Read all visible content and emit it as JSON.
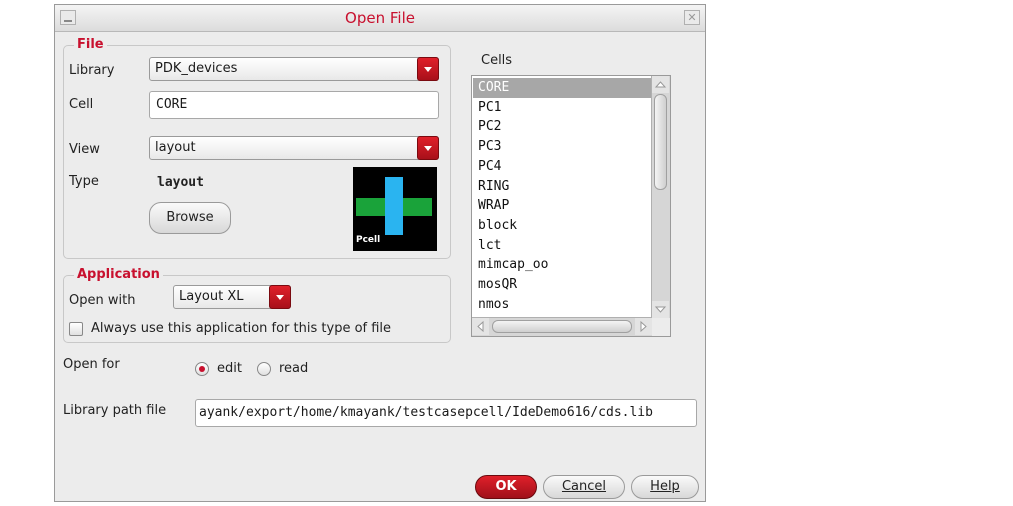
{
  "window": {
    "title": "Open File"
  },
  "file_group": {
    "legend": "File",
    "library_label": "Library",
    "library_value": "PDK_devices",
    "cell_label": "Cell",
    "cell_value": "CORE",
    "view_label": "View",
    "view_value": "layout",
    "type_label": "Type",
    "type_value": "layout",
    "browse_label": "Browse",
    "pcell_label": "Pcell"
  },
  "application_group": {
    "legend": "Application",
    "open_with_label": "Open with",
    "open_with_value": "Layout XL",
    "always_use_label": "Always use this application for this type of file",
    "always_use_checked": false
  },
  "cells": {
    "label": "Cells",
    "items": [
      "CORE",
      "PC1",
      "PC2",
      "PC3",
      "PC4",
      "RING",
      "WRAP",
      "block",
      "lct",
      "mimcap_oo",
      "mosQR",
      "nmos"
    ],
    "selected": "CORE"
  },
  "open_for": {
    "label": "Open for",
    "options": [
      "edit",
      "read"
    ],
    "selected": "edit"
  },
  "library_path": {
    "label": "Library path file",
    "value": "ayank/export/home/kmayank/testcasepcell/IdeDemo616/cds.lib"
  },
  "buttons": {
    "ok": "OK",
    "cancel": "Cancel",
    "help": "Help"
  },
  "colors": {
    "accent": "#c8102e",
    "selection": "#a7a7a7",
    "pcell_fill": "#1aa33a",
    "pcell_wire": "#2ab4f0"
  }
}
